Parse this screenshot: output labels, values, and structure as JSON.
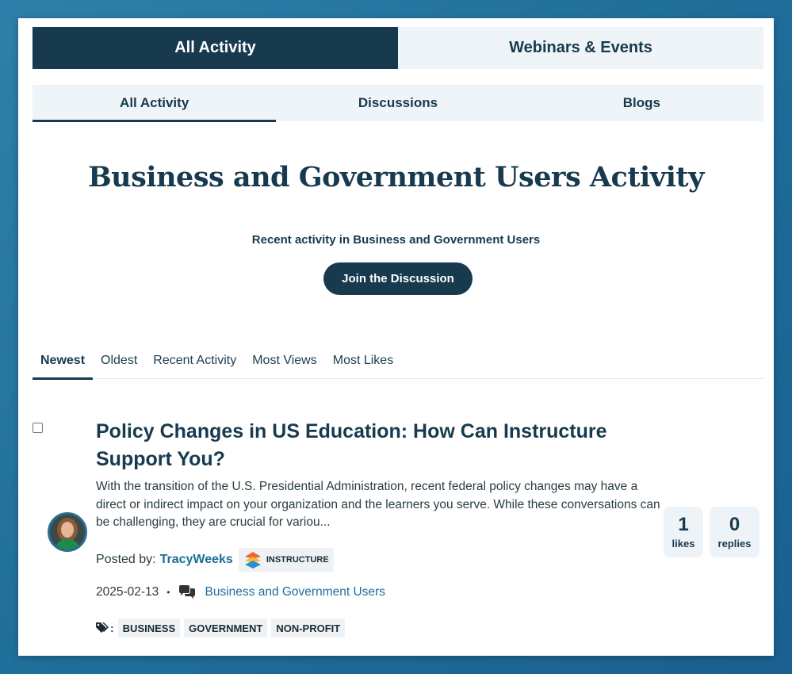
{
  "top_tabs": [
    {
      "label": "All Activity",
      "active": true
    },
    {
      "label": "Webinars & Events",
      "active": false
    }
  ],
  "sub_tabs": [
    {
      "label": "All Activity",
      "active": true
    },
    {
      "label": "Discussions",
      "active": false
    },
    {
      "label": "Blogs",
      "active": false
    }
  ],
  "page": {
    "title": "Business and Government Users Activity",
    "subtitle": "Recent activity in Business and Government Users",
    "join_button": "Join the Discussion"
  },
  "sort_tabs": [
    {
      "label": "Newest",
      "active": true
    },
    {
      "label": "Oldest",
      "active": false
    },
    {
      "label": "Recent Activity",
      "active": false
    },
    {
      "label": "Most Views",
      "active": false
    },
    {
      "label": "Most Likes",
      "active": false
    }
  ],
  "post": {
    "title": "Policy Changes in US Education: How Can Instructure Support You?",
    "excerpt": "With the transition of the U.S. Presidential Administration, recent federal policy changes may have a direct or indirect impact on your organization and the learners you serve. While these conversations can be challenging, they are crucial for variou...",
    "posted_by_label": "Posted by:",
    "author": "TracyWeeks",
    "badge": "INSTRUCTURE",
    "date": "2025-02-13",
    "bullet": "•",
    "community": "Business and Government Users",
    "tag_colon": ":",
    "tags": [
      "BUSINESS",
      "GOVERNMENT",
      "NON-PROFIT"
    ],
    "likes": "1",
    "likes_label": "likes",
    "replies": "0",
    "replies_label": "replies"
  },
  "colors": {
    "brand_dark": "#173a4e",
    "link": "#1a6f98",
    "light_bg": "#eef4f8",
    "background": "#2e7faa"
  },
  "icons": [
    "discussion-icon",
    "tag-icon",
    "instructure-logo-icon",
    "avatar"
  ]
}
